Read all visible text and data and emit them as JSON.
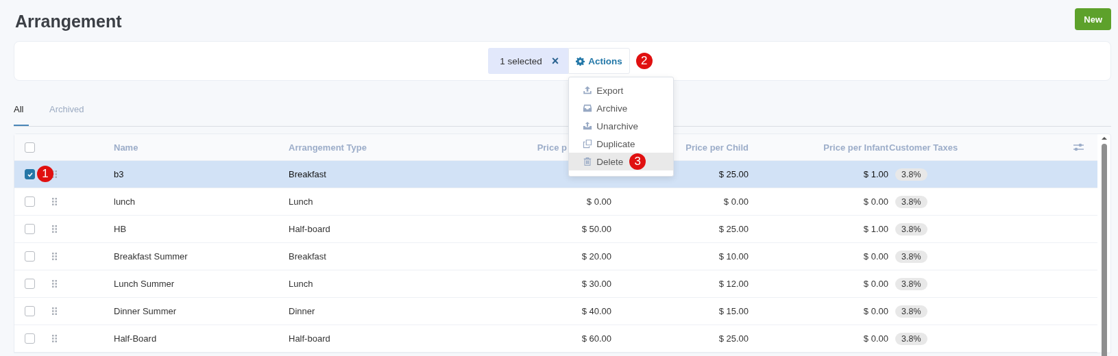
{
  "page": {
    "title": "Arrangement",
    "new_button": "New"
  },
  "toolbar": {
    "selection": {
      "count": "1",
      "text": "selected",
      "clear": "×"
    },
    "actions": {
      "label": "Actions",
      "callout": "2",
      "expanded": true,
      "menu": [
        {
          "kind": "export",
          "label": "Export",
          "selected": false
        },
        {
          "kind": "archive",
          "label": "Archive",
          "selected": false
        },
        {
          "kind": "unarchive",
          "label": "Unarchive",
          "selected": false
        },
        {
          "kind": "duplicate",
          "label": "Duplicate",
          "selected": false
        },
        {
          "kind": "delete",
          "label": "Delete",
          "selected": true,
          "callout": "3"
        }
      ]
    }
  },
  "tabs": [
    {
      "label": "All",
      "selected": true
    },
    {
      "label": "Archived",
      "selected": false
    }
  ],
  "table": {
    "all_checked": false,
    "columns": [
      "Name",
      "Arrangement Type",
      "Price p",
      "Price per Child",
      "Price per Infant",
      "Customer Taxes"
    ],
    "rows": [
      {
        "checked": true,
        "selected": true,
        "callout": "1",
        "cells": [
          "b3",
          "Breakfast",
          "",
          "$ 25.00",
          "$ 1.00",
          "3.8%"
        ]
      },
      {
        "checked": false,
        "selected": false,
        "cells": [
          "lunch",
          "Lunch",
          "$ 0.00",
          "$ 0.00",
          "$ 0.00",
          "3.8%"
        ]
      },
      {
        "checked": false,
        "selected": false,
        "cells": [
          "HB",
          "Half-board",
          "$ 50.00",
          "$ 25.00",
          "$ 1.00",
          "3.8%"
        ]
      },
      {
        "checked": false,
        "selected": false,
        "cells": [
          "Breakfast Summer",
          "Breakfast",
          "$ 20.00",
          "$ 10.00",
          "$ 0.00",
          "3.8%"
        ]
      },
      {
        "checked": false,
        "selected": false,
        "cells": [
          "Lunch Summer",
          "Lunch",
          "$ 30.00",
          "$ 12.00",
          "$ 0.00",
          "3.8%"
        ]
      },
      {
        "checked": false,
        "selected": false,
        "cells": [
          "Dinner Summer",
          "Dinner",
          "$ 40.00",
          "$ 15.00",
          "$ 0.00",
          "3.8%"
        ]
      },
      {
        "checked": false,
        "selected": false,
        "cells": [
          "Half-Board",
          "Half-board",
          "$ 60.00",
          "$ 25.00",
          "$ 0.00",
          "3.8%"
        ]
      }
    ]
  }
}
